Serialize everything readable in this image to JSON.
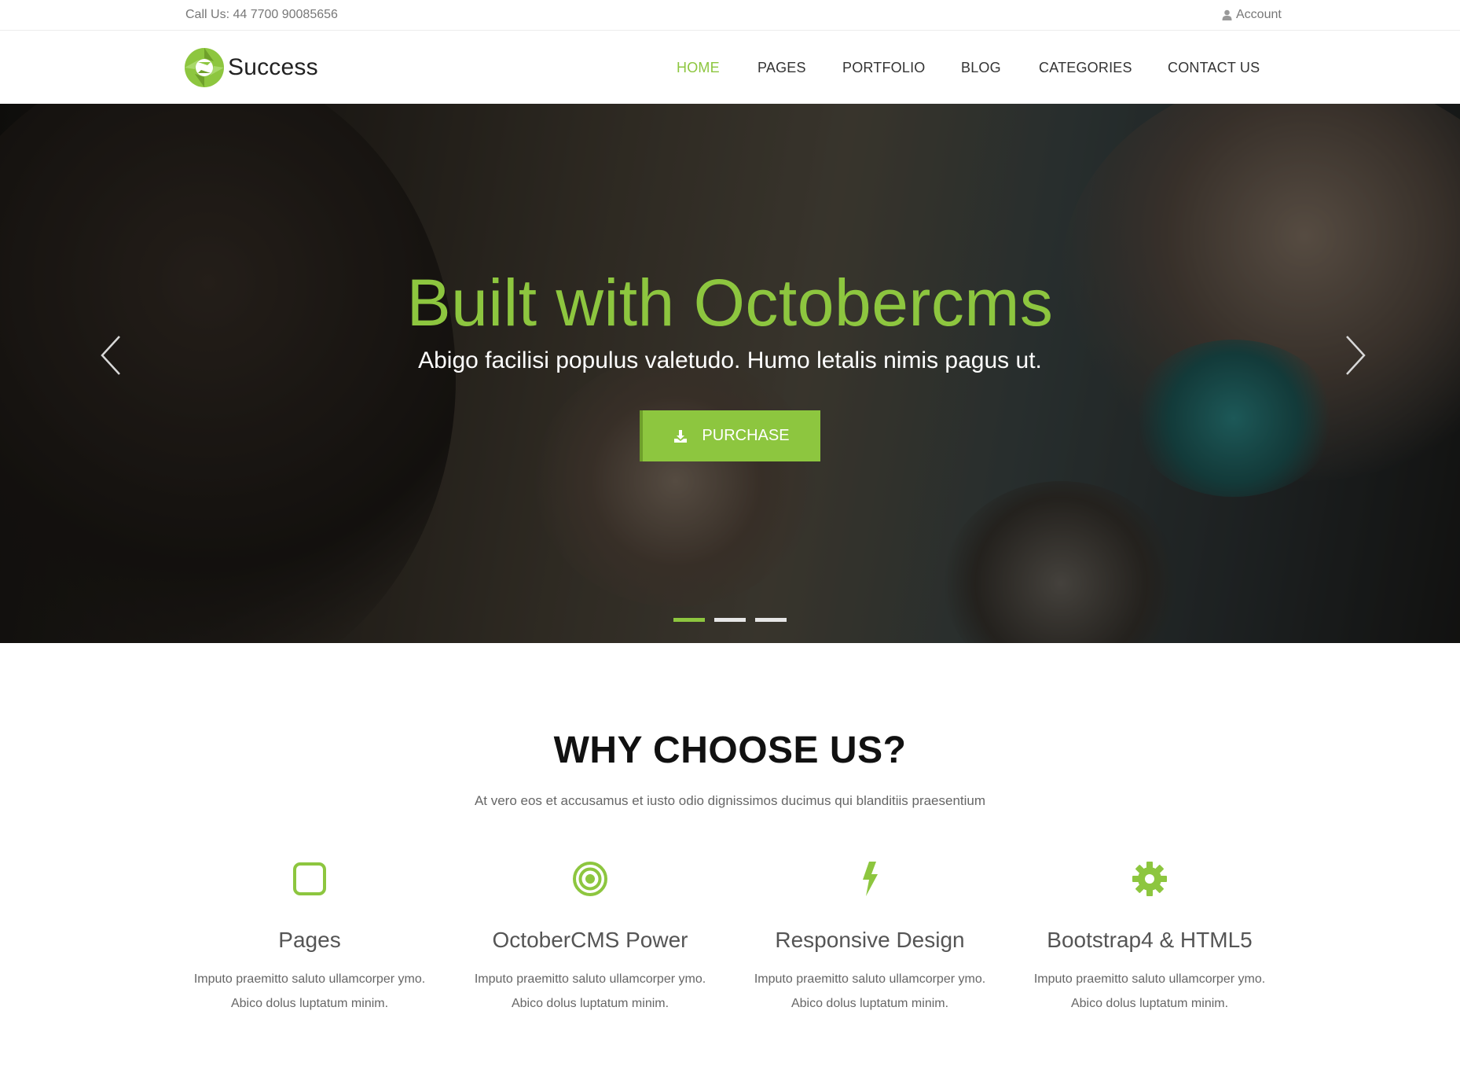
{
  "topbar": {
    "phone": "Call Us: 44 7700 90085656",
    "account_label": "Account"
  },
  "header": {
    "brand": "Success",
    "nav": [
      {
        "label": "HOME",
        "active": true
      },
      {
        "label": "PAGES",
        "active": false
      },
      {
        "label": "PORTFOLIO",
        "active": false
      },
      {
        "label": "BLOG",
        "active": false
      },
      {
        "label": "CATEGORIES",
        "active": false
      },
      {
        "label": "CONTACT US",
        "active": false
      }
    ]
  },
  "hero": {
    "title": "Built with Octobercms",
    "subtitle": "Abigo facilisi populus valetudo. Humo letalis nimis pagus ut.",
    "button_label": "PURCHASE",
    "button_icon": "download-icon",
    "slide_count": 3,
    "active_slide": 1
  },
  "why": {
    "title": "WHY CHOOSE US?",
    "subtitle": "At vero eos et accusamus et iusto odio dignissimos ducimus qui blanditiis praesentium",
    "features": [
      {
        "icon": "square-icon",
        "title": "Pages",
        "line1": "Imputo praemitto saluto ullamcorper ymo.",
        "line2": "Abico dolus luptatum minim."
      },
      {
        "icon": "bullseye-icon",
        "title": "OctoberCMS Power",
        "line1": "Imputo praemitto saluto ullamcorper ymo.",
        "line2": "Abico dolus luptatum minim."
      },
      {
        "icon": "bolt-icon",
        "title": "Responsive Design",
        "line1": "Imputo praemitto saluto ullamcorper ymo.",
        "line2": "Abico dolus luptatum minim."
      },
      {
        "icon": "gear-icon",
        "title": "Bootstrap4 & HTML5",
        "line1": "Imputo praemitto saluto ullamcorper ymo.",
        "line2": "Abico dolus luptatum minim."
      }
    ]
  },
  "colors": {
    "accent": "#8dc63f",
    "text_dark": "#333333",
    "text_muted": "#777777"
  }
}
